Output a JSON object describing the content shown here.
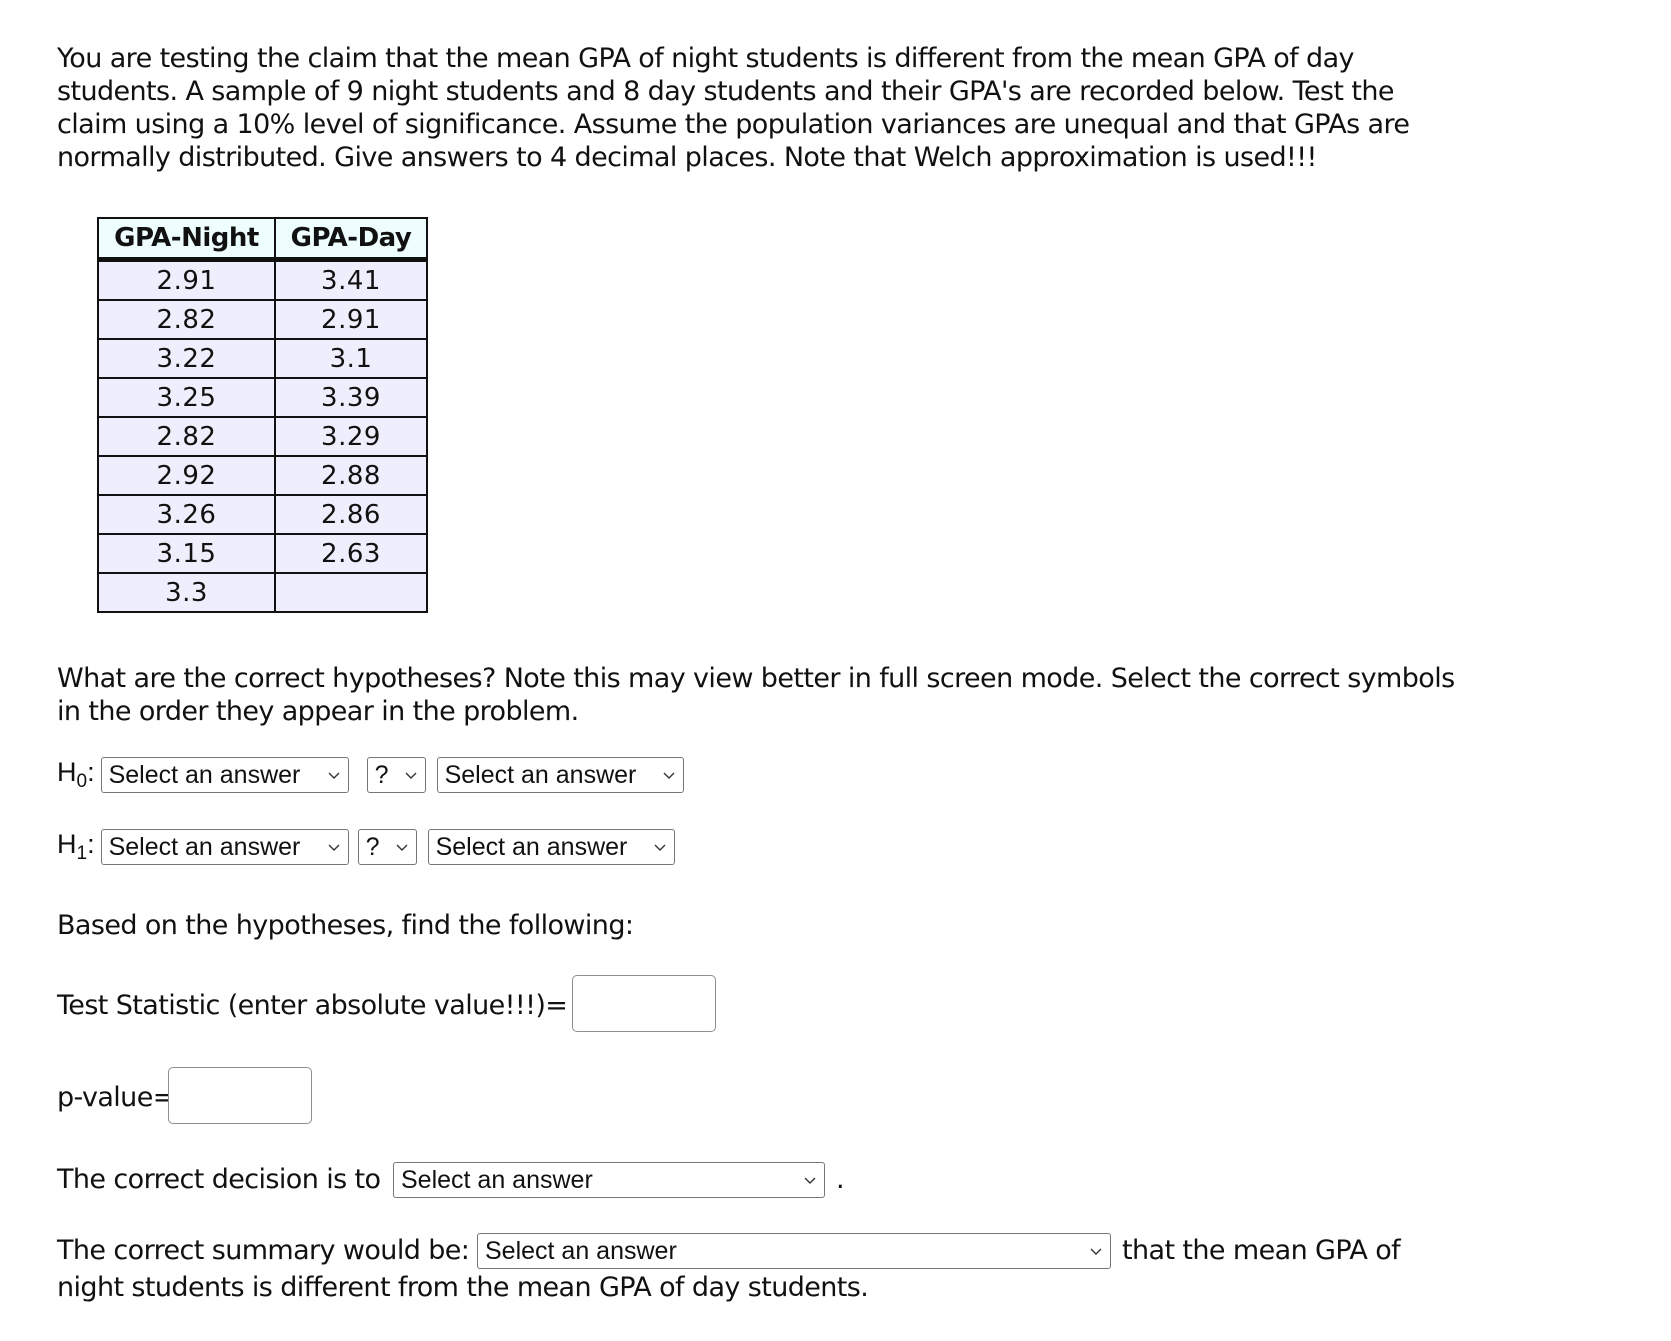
{
  "intro": "You are testing the claim that the mean GPA of night students is different from the mean GPA of day students. A sample of 9 night students and 8 day students and their GPA's are recorded below. Test the claim using a 10% level of significance. Assume the population variances are unequal and that GPAs are normally distributed. Give answers to 4 decimal places. Note that Welch approximation is used!!!",
  "table": {
    "headers": [
      "GPA-Night",
      "GPA-Day"
    ],
    "rows": [
      [
        "2.91",
        "3.41"
      ],
      [
        "2.82",
        "2.91"
      ],
      [
        "3.22",
        "3.1"
      ],
      [
        "3.25",
        "3.39"
      ],
      [
        "2.82",
        "3.29"
      ],
      [
        "2.92",
        "2.88"
      ],
      [
        "3.26",
        "2.86"
      ],
      [
        "3.15",
        "2.63"
      ],
      [
        "3.3",
        ""
      ]
    ]
  },
  "question": "What are the correct hypotheses? Note this may view better in full screen mode. Select the correct symbols in the order they appear in the problem.",
  "h0": {
    "label": "H",
    "sub": "0",
    "colon": ":",
    "left": "Select an answer",
    "op": "?",
    "right": "Select an answer"
  },
  "h1": {
    "label": "H",
    "sub": "1",
    "colon": ":",
    "left": "Select an answer",
    "op": "?",
    "right": "Select an answer"
  },
  "based_on": "Based on the hypotheses, find the following:",
  "test_statistic": {
    "label": "Test Statistic (enter absolute value!!!)=",
    "value": ""
  },
  "p_value": {
    "label": "p-value=",
    "value": ""
  },
  "decision": {
    "prefix": "The correct decision is to",
    "selected": "Select an answer",
    "suffix": "."
  },
  "summary": {
    "prefix": "The correct summary would be:",
    "selected": "Select an answer",
    "suffix_line1": "that the mean GPA of",
    "suffix_line2": "night students is different from the mean GPA of day students."
  }
}
